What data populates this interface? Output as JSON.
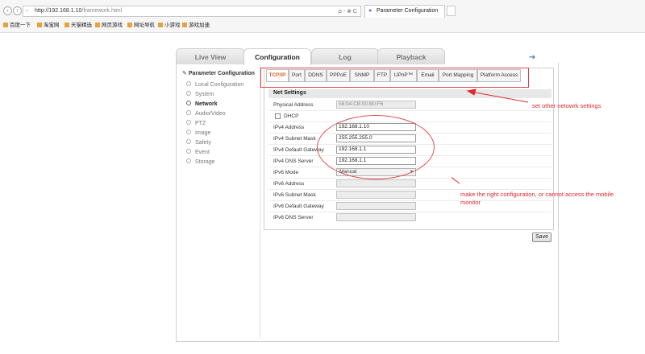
{
  "browser": {
    "url_host": "http://192.168.1.10",
    "url_path": "/framework.html",
    "search_hint": "ρ - ⊗ C",
    "tab_title": "Parameter Configuration",
    "bookmarks": [
      "百度一下",
      "淘宝网",
      "天猫精选",
      "网页游戏",
      "网址导航",
      "小游戏",
      "游戏加速"
    ]
  },
  "top_tabs": [
    "Live View",
    "Configuration",
    "Log",
    "Playback"
  ],
  "left_nav": {
    "title": "Parameter Configuration",
    "items": [
      "Local Configuration",
      "System",
      "Network",
      "Audio/Video",
      "PTZ",
      "Image",
      "Safety",
      "Event",
      "Storage"
    ],
    "selected": "Network"
  },
  "sub_tabs": [
    "TCP/IP",
    "Port",
    "DDNS",
    "PPPoE",
    "SNMP",
    "FTP",
    "UPnP™",
    "Email",
    "Port Mapping",
    "Platform Access"
  ],
  "net_settings": {
    "header": "Net Settings",
    "physical_address_label": "Physical Address",
    "physical_address": "58:04:CB:00:B0:F6",
    "dhcp_label": "DHCP",
    "ipv4_address_label": "IPv4 Address",
    "ipv4_address": "192.168.1.10",
    "ipv4_mask_label": "IPv4 Subnet Mask",
    "ipv4_mask": "255.255.255.0",
    "ipv4_gateway_label": "IPv4 Default Gateway",
    "ipv4_gateway": "192.168.1.1",
    "ipv4_dns_label": "IPv4 DNS Server",
    "ipv4_dns": "192.168.1.1",
    "ipv6_mode_label": "IPv6 Mode",
    "ipv6_mode": "Manual",
    "ipv6_address_label": "IPv6 Address",
    "ipv6_address": "::",
    "ipv6_mask_label": "IPv6 Subnet Mask",
    "ipv6_gateway_label": "IPv6 Default Gateway",
    "ipv6_dns_label": "IPv6 DNS Server"
  },
  "save_label": "Save",
  "annotations": {
    "tabs_note": "set other netowrk settings",
    "config_note_line1": "make the right configuration, or cannot access the mobile",
    "config_note_line2": "monitor"
  },
  "colors": {
    "annotation_red": "#e0282e",
    "active_tab": "#e06020"
  }
}
